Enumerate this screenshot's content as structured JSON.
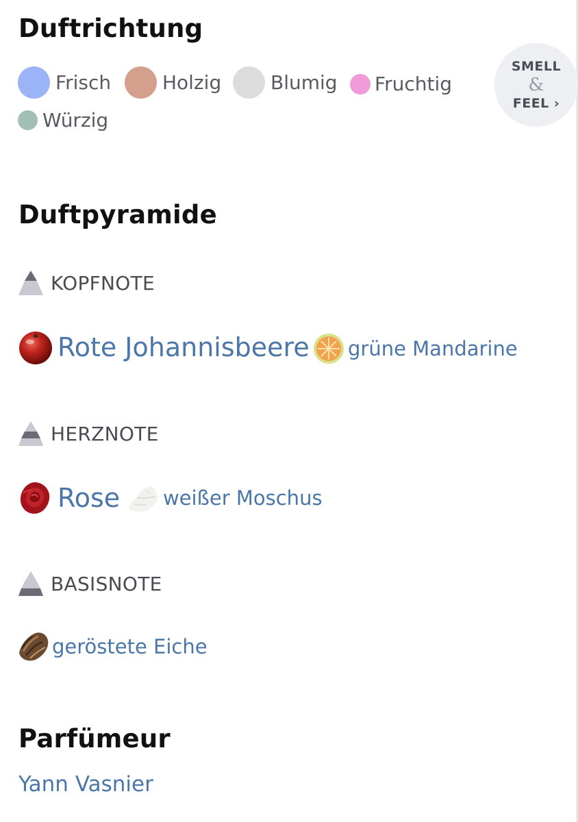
{
  "duftrichtung": {
    "title": "Duftrichtung",
    "accords": [
      {
        "label": "Frisch",
        "color": "#9bb4f7"
      },
      {
        "label": "Holzig",
        "color": "#d49f8c"
      },
      {
        "label": "Blumig",
        "color": "#dcdcdc"
      },
      {
        "label": "Fruchtig",
        "color": "#f09bd8"
      },
      {
        "label": "Würzig",
        "color": "#a2bfb6"
      }
    ],
    "smell_button": {
      "line1": "SMELL",
      "line2": "&",
      "line3": "FEEL ›"
    }
  },
  "duftpyramide": {
    "title": "Duftpyramide",
    "top": {
      "label": "KOPFNOTE",
      "icon": "pyramid-top-icon",
      "notes": [
        {
          "label": "Rote Johannisbeere",
          "icon": "red-currant-icon"
        },
        {
          "label": "grüne Mandarine",
          "icon": "mandarin-icon"
        }
      ]
    },
    "heart": {
      "label": "HERZNOTE",
      "icon": "pyramid-heart-icon",
      "notes": [
        {
          "label": "Rose",
          "icon": "rose-icon"
        },
        {
          "label": "weißer Moschus",
          "icon": "white-musk-icon"
        }
      ]
    },
    "base": {
      "label": "BASISNOTE",
      "icon": "pyramid-base-icon",
      "notes": [
        {
          "label": "geröstete Eiche",
          "icon": "roasted-oak-icon"
        }
      ]
    }
  },
  "parfumeur": {
    "title": "Parfümeur",
    "name": "Yann Vasnier"
  },
  "colors": {
    "link": "#4a76aa",
    "pyramid_dark": "#6b6b78",
    "pyramid_light": "#c8c8d2"
  }
}
